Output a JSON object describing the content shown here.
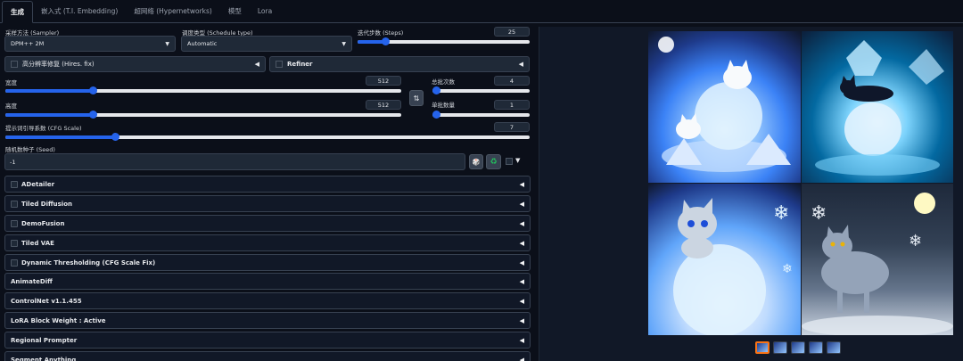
{
  "tabs": [
    "生成",
    "嵌入式 (T.I. Embedding)",
    "超网络 (Hypernetworks)",
    "模型",
    "Lora"
  ],
  "sampler": {
    "label": "采样方法 (Sampler)",
    "value": "DPM++ 2M"
  },
  "schedule": {
    "label": "调度类型 (Schedule type)",
    "value": "Automatic"
  },
  "steps": {
    "label": "迭代步数 (Steps)",
    "value": "25",
    "fraction": 0.16
  },
  "hires": {
    "label": "高分辨率修复 (Hires. fix)"
  },
  "refiner": {
    "label": "Refiner"
  },
  "width": {
    "label": "宽度",
    "value": "512",
    "fraction": 0.22
  },
  "height": {
    "label": "高度",
    "value": "512",
    "fraction": 0.22
  },
  "batch_count": {
    "label": "总批次数",
    "value": "4",
    "fraction": 0.03
  },
  "batch_size": {
    "label": "单批数量",
    "value": "1",
    "fraction": 0.0
  },
  "cfg": {
    "label": "提示词引导系数 (CFG Scale)",
    "value": "7",
    "fraction": 0.21
  },
  "seed": {
    "label": "随机数种子 (Seed)",
    "value": "-1"
  },
  "swap_icon": "⇅",
  "dice_icon": "🎲",
  "recycle_icon": "♻",
  "accordions": [
    {
      "label": "ADetailer",
      "checkbox": true
    },
    {
      "label": "Tiled Diffusion",
      "checkbox": true
    },
    {
      "label": "DemoFusion",
      "checkbox": true
    },
    {
      "label": "Tiled VAE",
      "checkbox": true
    },
    {
      "label": "Dynamic Thresholding (CFG Scale Fix)",
      "checkbox": true
    },
    {
      "label": "AnimateDiff",
      "checkbox": false
    },
    {
      "label": "ControlNet v1.1.455",
      "checkbox": false
    },
    {
      "label": "LoRA Block Weight : Active",
      "checkbox": false
    },
    {
      "label": "Regional Prompter",
      "checkbox": false
    },
    {
      "label": "Segment Anything",
      "checkbox": false
    }
  ],
  "colors": {
    "accent": "#2563eb",
    "background": "#0b0f19",
    "selected_thumb": "#f97316"
  }
}
